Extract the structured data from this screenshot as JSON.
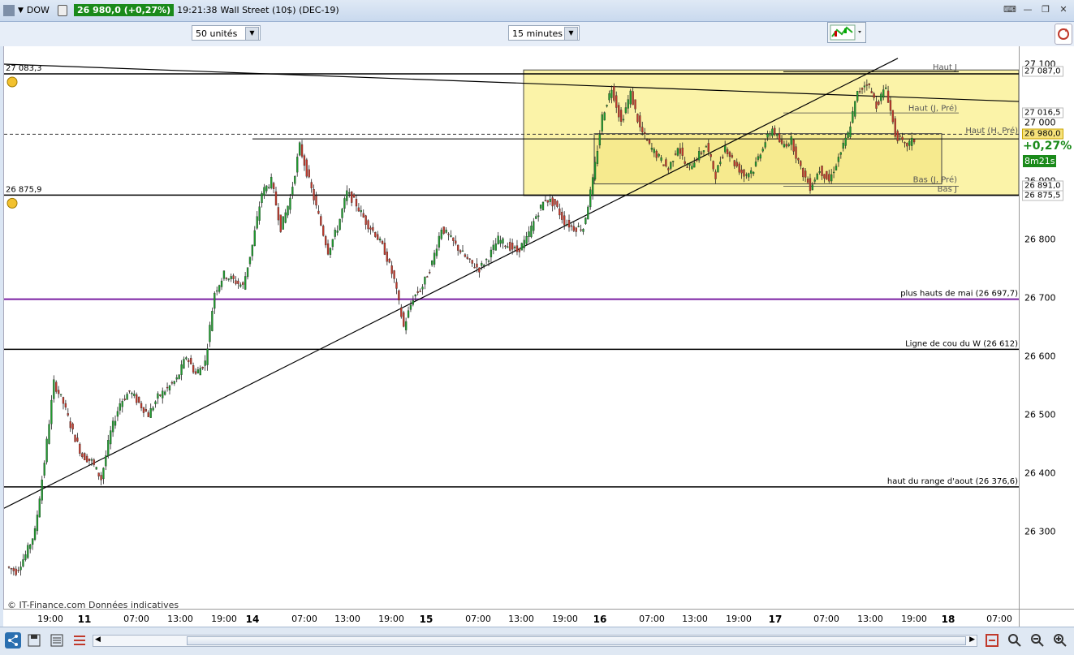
{
  "titlebar": {
    "symbol": "DOW",
    "price_change": "26 980,0 (+0,27%)",
    "time": "19:21:38",
    "instrument": "Wall Street (10$) (DEC-19)"
  },
  "toolbar": {
    "units_select": "50 unités",
    "interval_select": "15 minutes"
  },
  "chart_data": {
    "type": "candlestick",
    "title": "",
    "ylim": [
      26200,
      27110
    ],
    "y_ticks": [
      "27 100",
      "27 000",
      "26 900",
      "26 800",
      "26 700",
      "26 600",
      "26 500",
      "26 400",
      "26 300"
    ],
    "x_labels": [
      "19:00",
      "11",
      "07:00",
      "13:00",
      "19:00",
      "14",
      "07:00",
      "13:00",
      "19:00",
      "15",
      "07:00",
      "13:00",
      "19:00",
      "16",
      "07:00",
      "13:00",
      "19:00",
      "17",
      "07:00",
      "13:00",
      "19:00",
      "18",
      "07:00"
    ],
    "day_labels": [
      "11",
      "14",
      "15",
      "16",
      "17",
      "18"
    ],
    "current_price": "26 980,0",
    "change_percent": "+0,27%",
    "countdown": "8m21s",
    "price_labels": [
      {
        "value": 27087.0,
        "text": "27 087,0"
      },
      {
        "value": 27016.5,
        "text": "27 016,5"
      },
      {
        "value": 26891.0,
        "text": "26 891,0"
      },
      {
        "value": 26875.5,
        "text": "26 875,5"
      }
    ],
    "horizontal_levels": [
      {
        "value": 27083.3,
        "label": "27 083,3",
        "color": "#000000"
      },
      {
        "value": 26875.9,
        "label": "26 875,9",
        "color": "#000000"
      },
      {
        "value": 26697.7,
        "label": "plus hauts de mai (26 697,7)",
        "color": "#7a1fa2"
      },
      {
        "value": 26612,
        "label": "Ligne de cou du W (26 612)",
        "color": "#000000"
      },
      {
        "value": 26376.6,
        "label": "haut du range d'aout (26 376,6)",
        "color": "#000000"
      }
    ],
    "zone_labels": [
      "Haut J",
      "Haut (J, Pré)",
      "Haut (H, Pré)",
      "Bas (J, Pré)",
      "Bas J"
    ],
    "series_close": [
      26240,
      26232,
      26260,
      26300,
      26420,
      26555,
      26520,
      26470,
      26430,
      26420,
      26390,
      26470,
      26520,
      26540,
      26520,
      26500,
      26530,
      26545,
      26560,
      26600,
      26570,
      26590,
      26710,
      26740,
      26730,
      26720,
      26790,
      26880,
      26900,
      26820,
      26870,
      26960,
      26900,
      26840,
      26780,
      26820,
      26880,
      26860,
      26830,
      26810,
      26780,
      26730,
      26650,
      26700,
      26720,
      26760,
      26820,
      26800,
      26780,
      26760,
      26750,
      26770,
      26800,
      26790,
      26780,
      26800,
      26840,
      26870,
      26860,
      26830,
      26820,
      26820,
      26900,
      27010,
      27060,
      27000,
      27050,
      26990,
      26960,
      26940,
      26920,
      26960,
      26920,
      26940,
      26960,
      26910,
      26960,
      26930,
      26910,
      26920,
      26960,
      26990,
      26960,
      26970,
      26920,
      26890,
      26920,
      26900,
      26940,
      26980,
      27050,
      27070,
      27030,
      27060,
      26980,
      26960,
      26970
    ]
  },
  "copyright": "© IT-Finance.com  Données indicatives",
  "icons": {
    "share": "share-icon",
    "save": "save-icon",
    "bars": "bars-icon",
    "scroll_left": "chevron-left-icon",
    "scroll_right": "chevron-right-icon",
    "chart_type": "candlestick-icon",
    "settings": "settings-icon",
    "zoom_fit": "zoom-fit-icon",
    "zoom_out": "zoom-out-icon",
    "zoom_in": "zoom-in-icon"
  }
}
